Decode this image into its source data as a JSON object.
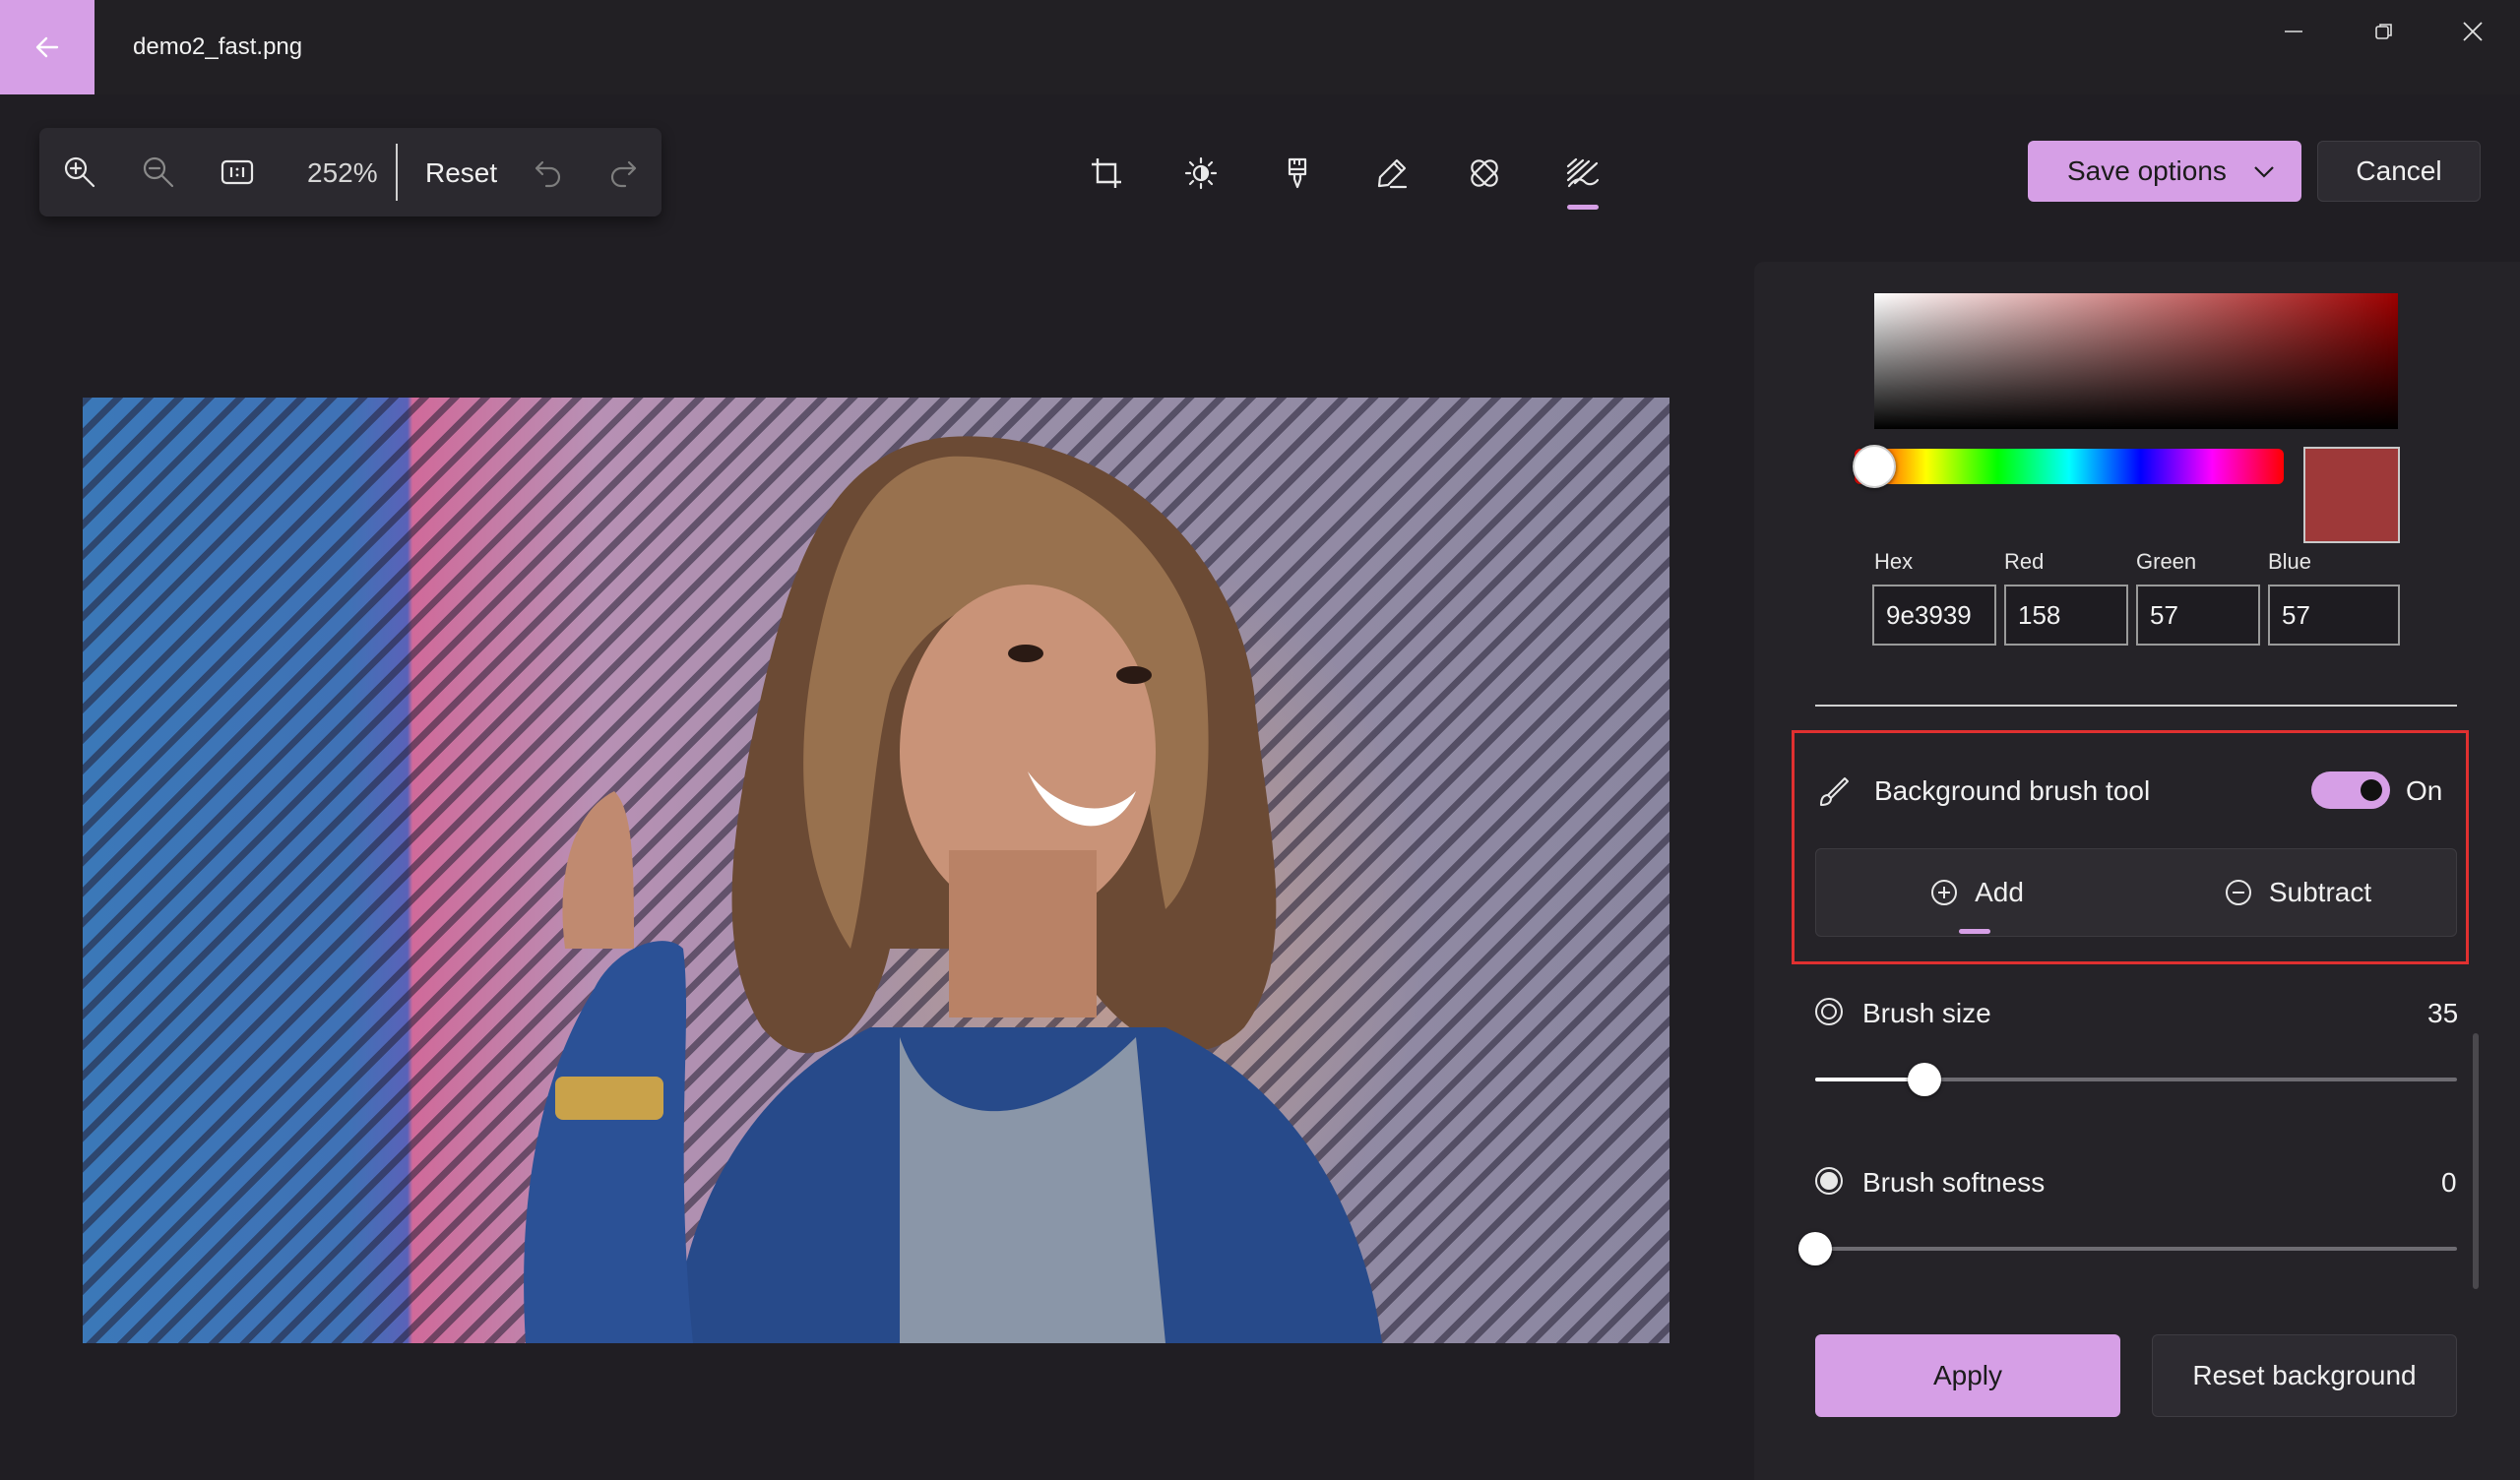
{
  "window": {
    "file_name": "demo2_fast.png"
  },
  "toolbar": {
    "zoom_level": "252%",
    "reset_label": "Reset",
    "icons": [
      "zoom-in-icon",
      "zoom-out-icon",
      "actual-size-icon",
      "undo-icon",
      "redo-icon"
    ]
  },
  "tools": {
    "icons": [
      "crop-icon",
      "adjustment-icon",
      "filter-icon",
      "markup-icon",
      "retouch-icon",
      "background-icon"
    ],
    "active": "background-icon"
  },
  "actions": {
    "save_label": "Save options",
    "cancel_label": "Cancel"
  },
  "color_picker": {
    "labels": {
      "hex": "Hex",
      "red": "Red",
      "green": "Green",
      "blue": "Blue"
    },
    "values": {
      "hex": "9e3939",
      "red": "158",
      "green": "57",
      "blue": "57"
    },
    "swatch_color": "#9e3939"
  },
  "brush_tool": {
    "label": "Background brush tool",
    "toggle_label": "On",
    "toggle_on": true,
    "add_label": "Add",
    "subtract_label": "Subtract",
    "active_mode": "Add"
  },
  "brush_size": {
    "label": "Brush size",
    "value": "35",
    "fraction": 0.17
  },
  "brush_softness": {
    "label": "Brush softness",
    "value": "0",
    "fraction": 0
  },
  "footer": {
    "apply_label": "Apply",
    "reset_background_label": "Reset background"
  },
  "colors": {
    "accent": "#d69fe6",
    "background": "#201e23",
    "panel": "#252328",
    "highlight_border": "#e03030"
  }
}
